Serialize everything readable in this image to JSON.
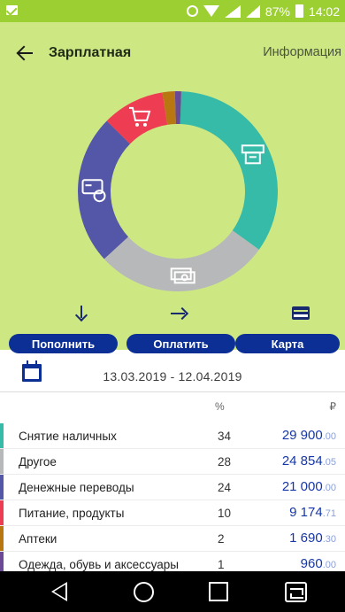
{
  "status_bar": {
    "battery": "87%",
    "time": "14:02"
  },
  "header": {
    "title": "Зарплатная",
    "info_link": "Информация"
  },
  "chart_data": {
    "type": "pie",
    "style": "donut",
    "slices": [
      {
        "label": "Снятие наличных",
        "percent": 34,
        "color": "#35bba8",
        "icon": "atm-icon"
      },
      {
        "label": "Другое",
        "percent": 28,
        "color": "#b7b8b9",
        "icon": "cash-icon"
      },
      {
        "label": "Денежные переводы",
        "percent": 24,
        "color": "#5456a8",
        "icon": "transfer-card-icon"
      },
      {
        "label": "Питание, продукты",
        "percent": 10,
        "color": "#ee3c53",
        "icon": "shopping-cart-icon"
      },
      {
        "label": "Аптеки",
        "percent": 2,
        "color": "#b97712",
        "icon": ""
      },
      {
        "label": "Одежда, обувь и аксессуары",
        "percent": 1,
        "color": "#6a4a97",
        "icon": ""
      }
    ]
  },
  "actions": {
    "topup": "Пополнить",
    "pay": "Оплатить",
    "card": "Карта"
  },
  "period": {
    "range": "13.03.2019 - 12.04.2019"
  },
  "table": {
    "pct_header": "%",
    "currency_header": "₽",
    "rows": [
      {
        "label": "Снятие наличных",
        "pct": "34",
        "amount": "29 900",
        "cents": ".00",
        "color": "#35bba8"
      },
      {
        "label": "Другое",
        "pct": "28",
        "amount": "24 854",
        "cents": ".05",
        "color": "#b7b8b9"
      },
      {
        "label": "Денежные переводы",
        "pct": "24",
        "amount": "21 000",
        "cents": ".00",
        "color": "#5456a8"
      },
      {
        "label": "Питание, продукты",
        "pct": "10",
        "amount": "9 174",
        "cents": ".71",
        "color": "#ee3c53"
      },
      {
        "label": "Аптеки",
        "pct": "2",
        "amount": "1 690",
        "cents": ".30",
        "color": "#b97712"
      },
      {
        "label": "Одежда, обувь и аксессуары",
        "pct": "1",
        "amount": "960",
        "cents": ".00",
        "color": "#6a4a97"
      }
    ]
  }
}
